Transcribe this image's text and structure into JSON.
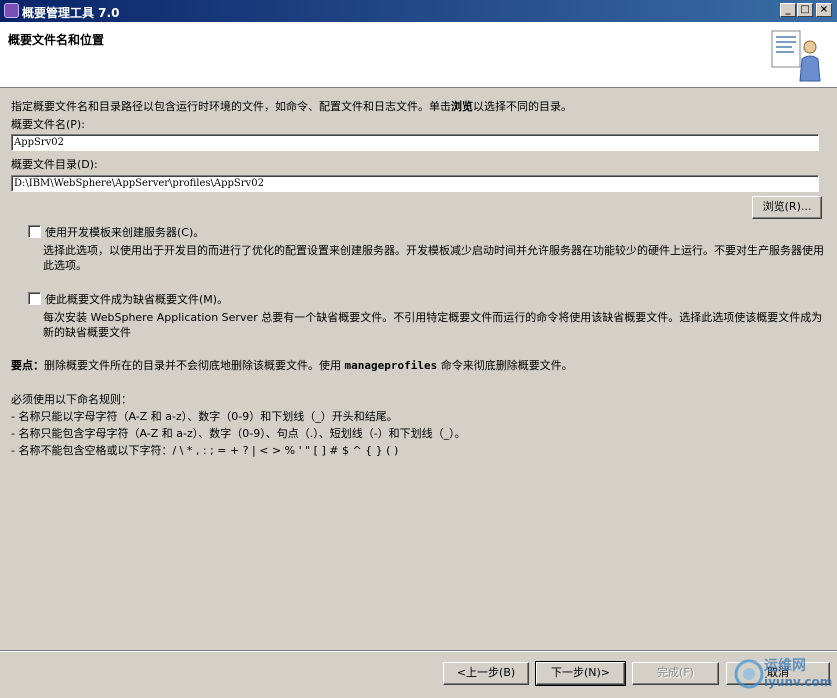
{
  "window": {
    "title": "概要管理工具 7.0",
    "minimize": "_",
    "maximize": "□",
    "close": "×"
  },
  "header": {
    "title": "概要文件名和位置"
  },
  "intro": {
    "before": "指定概要文件名和目录路径以包含运行时环境的文件，如命令、配置文件和日志文件。单击",
    "bold": "浏览",
    "after": "以选择不同的目录。"
  },
  "profile_name": {
    "label": "概要文件名(P):",
    "value": "AppSrv02"
  },
  "profile_dir": {
    "label": "概要文件目录(D):",
    "value": "D:\\IBM\\WebSphere\\AppServer\\profiles\\AppSrv02"
  },
  "browse_label": "浏览(R)...",
  "dev_template": {
    "label": "使用开发模板来创建服务器(C)。",
    "checked": false,
    "desc": "选择此选项，以使用出于开发目的而进行了优化的配置设置来创建服务器。开发模板减少启动时间并允许服务器在功能较少的硬件上运行。不要对生产服务器使用此选项。"
  },
  "default_profile": {
    "label": "使此概要文件成为缺省概要文件(M)。",
    "checked": false,
    "desc": "每次安装 WebSphere Application Server 总要有一个缺省概要文件。不引用特定概要文件而运行的命令将使用该缺省概要文件。选择此选项使该概要文件成为新的缺省概要文件"
  },
  "important": {
    "label": "要点：",
    "before": "删除概要文件所在的目录并不会彻底地删除该概要文件。使用 ",
    "cmd": "manageprofiles",
    "after": " 命令来彻底删除概要文件。"
  },
  "rules": {
    "heading": "必须使用以下命名规则：",
    "items": [
      "-  名称只能以字母字符（A-Z 和 a-z）、数字（0-9）和下划线（_）开头和结尾。",
      "-  名称只能包含字母字符（A-Z 和 a-z）、数字（0-9）、句点（.）、短划线（-）和下划线（_）。",
      "-  名称不能包含空格或以下字符：/ \\ * , : ; = + ? | < >  % ' \" [ ] # $ ^ { } ( )"
    ]
  },
  "footer": {
    "back": "<上一步(B)",
    "next": "下一步(N)>",
    "finish": "完成(F)",
    "cancel": "取消"
  },
  "watermark": {
    "text1": "运维网",
    "text2": "iyunv.com"
  }
}
